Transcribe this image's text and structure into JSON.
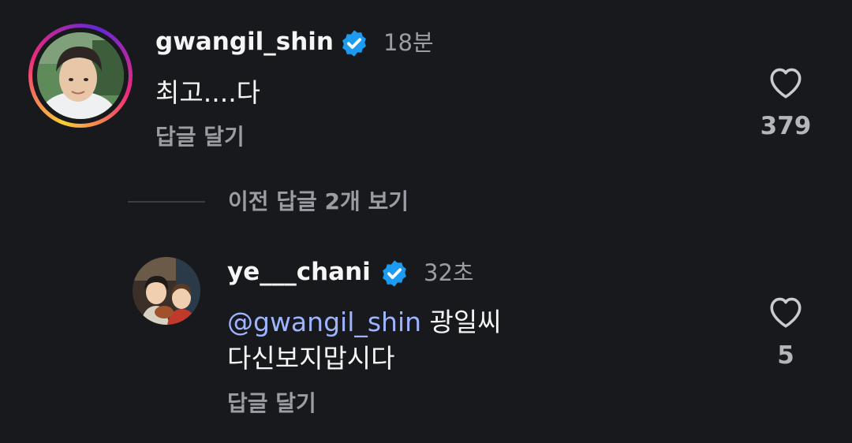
{
  "comments": [
    {
      "username": "gwangil_shin",
      "time": "18분",
      "text": "최고....다",
      "reply_label": "답글 달기",
      "likes": "379"
    }
  ],
  "more_replies_label": "이전 답글 2개 보기",
  "replies": [
    {
      "username": "ye___chani",
      "time": "32초",
      "mention": "@gwangil_shin",
      "text_line1_rest": " 광일씨",
      "text_line2": "다신보지맙시다",
      "reply_label": "답글 달기",
      "likes": "5"
    }
  ],
  "colors": {
    "background": "#17191c",
    "mention": "#9fb4ff",
    "verified": "#1d9bf0",
    "muted": "#9a9ea4"
  },
  "icons": [
    "verified-badge-icon",
    "heart-icon"
  ]
}
